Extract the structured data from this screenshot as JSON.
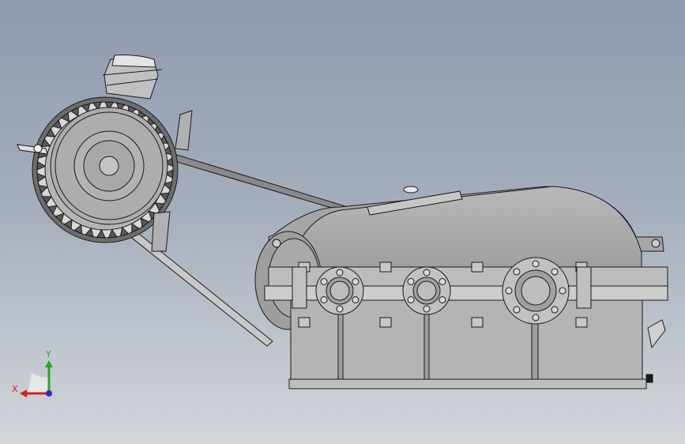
{
  "viewport": {
    "background_top": "#8f9cae",
    "background_bottom": "#d3d6db"
  },
  "model": {
    "parts": [
      "motor",
      "drive-pulley",
      "v-belt",
      "gearbox-housing",
      "shaft-flange-1",
      "shaft-flange-2",
      "shaft-flange-3",
      "breather-cap",
      "oil-drain-plug"
    ],
    "part_color": "#a9a9a9",
    "edge_color": "#1a1a1a"
  },
  "triad": {
    "x_label": "X",
    "y_label": "Y",
    "x_color": "#cc2222",
    "y_color": "#22aa22",
    "z_color": "#2233cc"
  }
}
